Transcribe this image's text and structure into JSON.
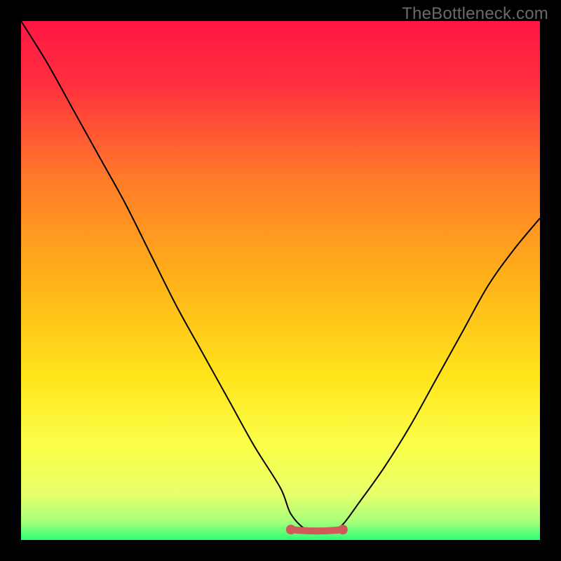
{
  "watermark": "TheBottleneck.com",
  "chart_data": {
    "type": "line",
    "title": "",
    "xlabel": "",
    "ylabel": "",
    "xlim": [
      0,
      100
    ],
    "ylim": [
      0,
      100
    ],
    "x": [
      0,
      5,
      10,
      15,
      20,
      25,
      30,
      35,
      40,
      45,
      50,
      52,
      55,
      58,
      60,
      62,
      65,
      70,
      75,
      80,
      85,
      90,
      95,
      100
    ],
    "values": [
      100,
      92,
      83,
      74,
      65,
      55,
      45,
      36,
      27,
      18,
      10,
      5,
      2,
      2,
      2,
      3,
      7,
      14,
      22,
      31,
      40,
      49,
      56,
      62
    ],
    "flat_region": {
      "x_start": 52,
      "x_end": 62,
      "y": 2,
      "color": "#d05a58"
    },
    "background_gradient": {
      "stops": [
        {
          "offset": 0.0,
          "color": "#ff1744"
        },
        {
          "offset": 0.12,
          "color": "#ff2f3e"
        },
        {
          "offset": 0.3,
          "color": "#ff7a2a"
        },
        {
          "offset": 0.5,
          "color": "#ffb219"
        },
        {
          "offset": 0.68,
          "color": "#ffe31a"
        },
        {
          "offset": 0.82,
          "color": "#fbff4a"
        },
        {
          "offset": 0.91,
          "color": "#e8ff6a"
        },
        {
          "offset": 0.965,
          "color": "#a8ff7a"
        },
        {
          "offset": 1.0,
          "color": "#2cff74"
        }
      ]
    }
  }
}
